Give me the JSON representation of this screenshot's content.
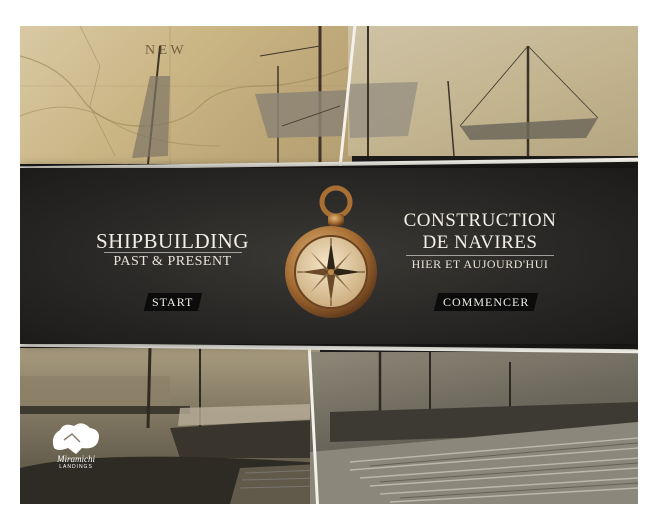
{
  "banner": {
    "english": {
      "title": "SHIPBUILDING",
      "subtitle": "PAST & PRESENT",
      "button": "START"
    },
    "french": {
      "title_line1": "CONSTRUCTION",
      "title_line2": "DE NAVIRES",
      "subtitle": "HIER ET AUJOURD'HUI",
      "button": "COMMENCER"
    }
  },
  "logo": {
    "name": "Miramichi",
    "tagline": "LANDINGS"
  },
  "map_text": "N E W",
  "colors": {
    "banner": "#2a2826",
    "text": "#f2efe8",
    "button": "#0b0b0b",
    "sepia": "#c4b691"
  }
}
